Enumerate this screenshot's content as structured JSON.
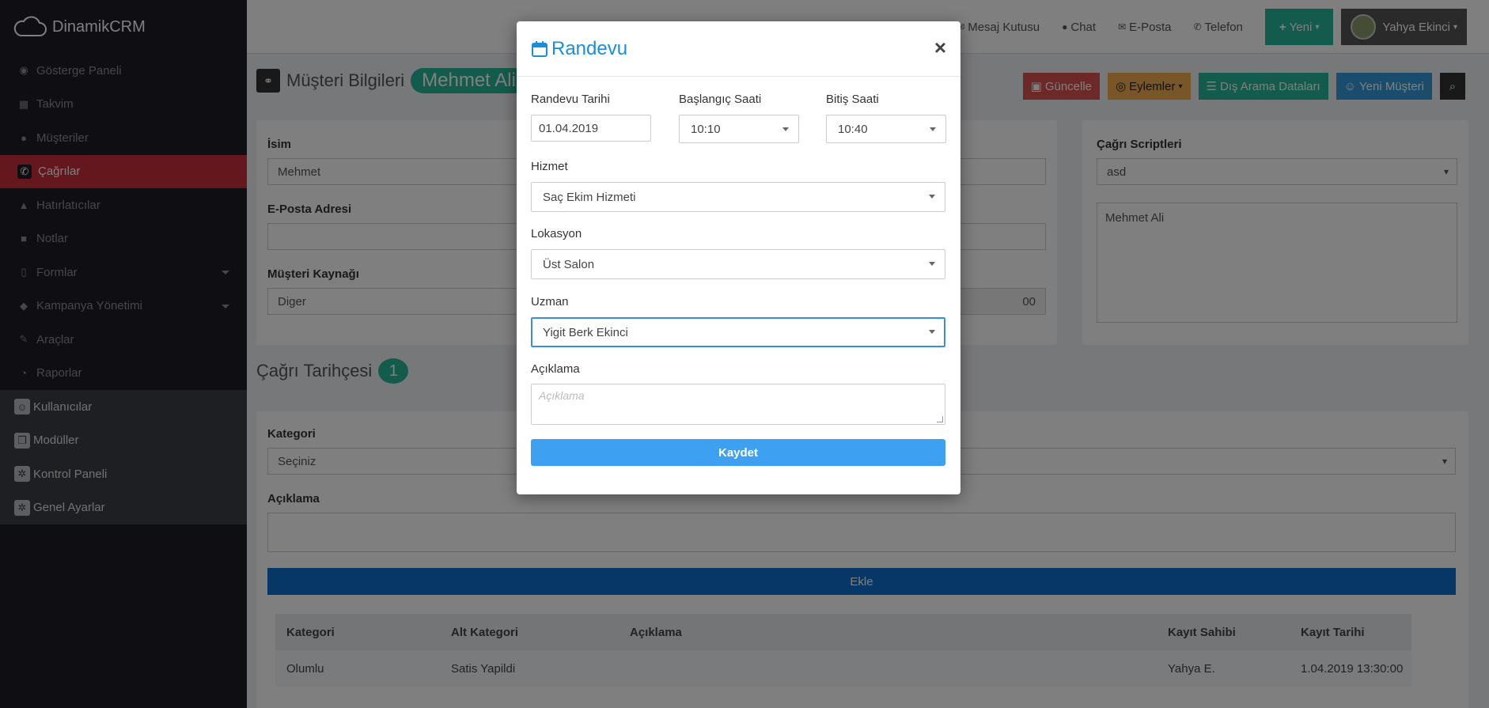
{
  "app": {
    "name": "DinamikCRM"
  },
  "sidebar": {
    "items": [
      {
        "label": "Gösterge Paneli",
        "icon": "dashboard-icon",
        "glyph": "◉"
      },
      {
        "label": "Takvim",
        "icon": "calendar-icon",
        "glyph": "▦"
      },
      {
        "label": "Müşteriler",
        "icon": "users-icon",
        "glyph": "●"
      },
      {
        "label": "Çağrılar",
        "icon": "phone-icon",
        "glyph": "✆"
      },
      {
        "label": "Hatırlatıcılar",
        "icon": "bell-icon",
        "glyph": "▲"
      },
      {
        "label": "Notlar",
        "icon": "note-icon",
        "glyph": "■"
      },
      {
        "label": "Formlar",
        "icon": "file-icon",
        "glyph": "▯"
      },
      {
        "label": "Kampanya Yönetimi",
        "icon": "bullhorn-icon",
        "glyph": "◆"
      },
      {
        "label": "Araçlar",
        "icon": "wrench-icon",
        "glyph": "✎"
      },
      {
        "label": "Raporlar",
        "icon": "pie-chart-icon",
        "glyph": "◔"
      }
    ],
    "admin_items": [
      {
        "label": "Kullanıcılar",
        "icon": "user-icon",
        "glyph": "☺"
      },
      {
        "label": "Modüller",
        "icon": "cube-icon",
        "glyph": "❒"
      },
      {
        "label": "Kontrol Paneli",
        "icon": "gear-icon",
        "glyph": "✲"
      },
      {
        "label": "Genel Ayarlar",
        "icon": "settings-icon",
        "glyph": "✲"
      }
    ]
  },
  "topbar": {
    "links": [
      {
        "label": "Mesaj Kutusu",
        "glyph": "✉"
      },
      {
        "label": "Chat",
        "glyph": "●"
      },
      {
        "label": "E-Posta",
        "glyph": "✉"
      },
      {
        "label": "Telefon",
        "glyph": "✆"
      }
    ],
    "new_button": "Yeni",
    "user_name": "Yahya Ekinci"
  },
  "page": {
    "title": "Müşteri Bilgileri",
    "customer_badge": "Mehmet Ali",
    "actions": {
      "update": "Güncelle",
      "actions": "Eylemler",
      "external": "Dış Arama Dataları",
      "new_customer": "Yeni Müşteri"
    }
  },
  "form": {
    "name_label": "İsim",
    "name_value": "Mehmet",
    "email_label": "E-Posta Adresi",
    "email_value": "",
    "source_label": "Müşteri Kaynağı",
    "source_value": "Diger",
    "hidden_partial": "00"
  },
  "scripts_panel": {
    "label": "Çağrı Scriptleri",
    "select_value": "asd",
    "text": "Mehmet Ali"
  },
  "history": {
    "title": "Çağrı Tarihçesi",
    "count": "1",
    "category_label": "Kategori",
    "category_value": "Seçiniz",
    "desc_label": "Açıklama",
    "add_button": "Ekle",
    "columns": [
      "Kategori",
      "Alt Kategori",
      "Açıklama",
      "Kayıt Sahibi",
      "Kayıt Tarihi"
    ],
    "rows": [
      [
        "Olumlu",
        "Satis Yapildi",
        "",
        "Yahya E.",
        "1.04.2019 13:30:00"
      ]
    ]
  },
  "modal": {
    "title": "Randevu",
    "close": "×",
    "date_label": "Randevu Tarihi",
    "date_value": "01.04.2019",
    "start_label": "Başlangıç Saati",
    "start_value": "10:10",
    "end_label": "Bitiş Saati",
    "end_value": "10:40",
    "service_label": "Hizmet",
    "service_value": "Saç Ekim Hizmeti",
    "location_label": "Lokasyon",
    "location_value": "Üst Salon",
    "expert_label": "Uzman",
    "expert_value": "Yigit Berk Ekinci",
    "desc_label": "Açıklama",
    "desc_placeholder": "Açıklama",
    "save_button": "Kaydet"
  },
  "colors": {
    "accent_green": "#26b99a",
    "active_red": "#c9303c",
    "modal_blue": "#1a8fd8",
    "save_blue": "#3ea0f0",
    "add_blue": "#0d6ecf"
  }
}
